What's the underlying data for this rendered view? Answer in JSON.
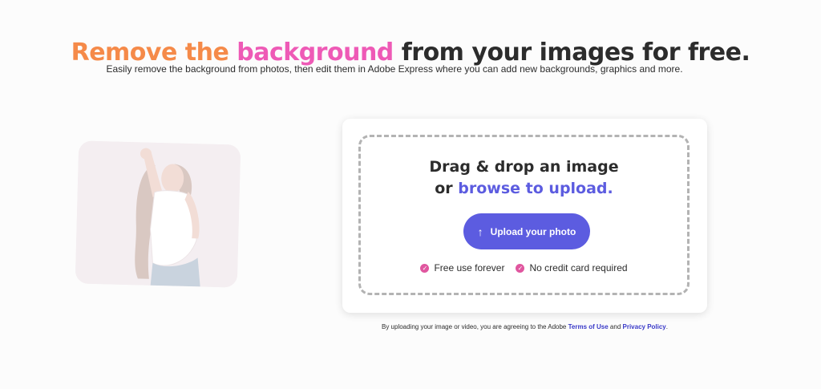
{
  "hero": {
    "title_part1": "Remove the ",
    "title_part2": "background",
    "title_part3": " from your images for free.",
    "subtitle": "Easily remove the background from photos, then edit them in Adobe Express where you can add new backgrounds, graphics and more."
  },
  "upload": {
    "drop_text": "Drag & drop an image",
    "or_text": "or ",
    "browse_link": "browse to upload.",
    "button_label": "Upload your photo",
    "button_icon": "upload-arrow-icon",
    "checks": [
      {
        "label": "Free use forever",
        "icon": "check-icon"
      },
      {
        "label": "No credit card required",
        "icon": "check-icon"
      }
    ]
  },
  "legal": {
    "prefix": "By uploading your image or video, you are agreeing to the Adobe ",
    "terms_link": "Terms of Use",
    "and_text": " and ",
    "privacy_link": "Privacy Policy",
    "suffix": "."
  },
  "colors": {
    "accent": "#5c5ce0",
    "title_orange": "#f58a49",
    "title_pink": "#ee5ab6",
    "check_pink": "#e0569f"
  }
}
